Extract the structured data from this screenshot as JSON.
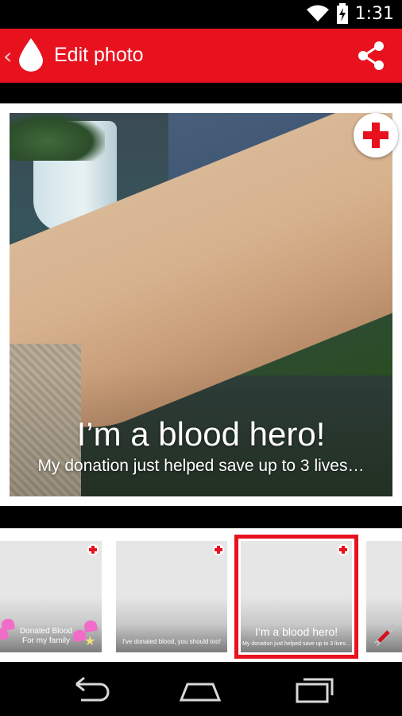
{
  "status_bar": {
    "time": "1:31"
  },
  "action_bar": {
    "title": "Edit photo",
    "back_glyph": "‹"
  },
  "editor": {
    "headline": "I’m a blood hero!",
    "subtext": "My donation just helped save up to 3 lives…"
  },
  "thumbnails": [
    {
      "line1": "Donated Blood",
      "line2": "For my family"
    },
    {
      "line1": "I've donated blood, you should too!"
    },
    {
      "headline": "I’m a blood hero!",
      "subtext": "My donation just helped save up to 3 lives..."
    },
    {
      "icon": "syringe-icon"
    }
  ],
  "colors": {
    "brand_red": "#e8121f",
    "white": "#ffffff",
    "black": "#000000"
  },
  "icons": [
    "wifi-icon",
    "battery-icon",
    "blood-drop-icon",
    "share-icon",
    "add-badge-icon",
    "back-nav-icon",
    "home-nav-icon",
    "recents-nav-icon"
  ]
}
